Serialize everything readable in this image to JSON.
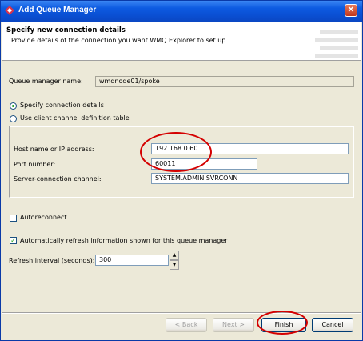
{
  "window": {
    "title": "Add Queue Manager"
  },
  "header": {
    "title": "Specify new connection details",
    "subtitle": "Provide details of the connection you want WMQ Explorer to set up"
  },
  "queue_manager": {
    "label": "Queue manager name:",
    "value": "wmqnode01/spoke"
  },
  "connection_mode": {
    "options": [
      "Specify connection details",
      "Use client channel definition table"
    ],
    "selected": "Specify connection details"
  },
  "connection": {
    "host_label": "Host name or IP address:",
    "host_value": "192.168.0.60",
    "port_label": "Port number:",
    "port_value": "60011",
    "channel_label": "Server-connection channel:",
    "channel_value": "SYSTEM.ADMIN.SVRCONN"
  },
  "autoreconnect": {
    "label": "Autoreconnect",
    "checked": false
  },
  "auto_refresh": {
    "label": "Automatically refresh information shown for this queue manager",
    "checked": true
  },
  "refresh_interval": {
    "label": "Refresh interval (seconds):",
    "value": "300"
  },
  "buttons": {
    "back": "< Back",
    "next": "Next >",
    "finish": "Finish",
    "cancel": "Cancel"
  },
  "annotation_color": "#d40000",
  "icons": [
    "app-icon",
    "close-icon",
    "spin-up-icon",
    "spin-down-icon"
  ]
}
